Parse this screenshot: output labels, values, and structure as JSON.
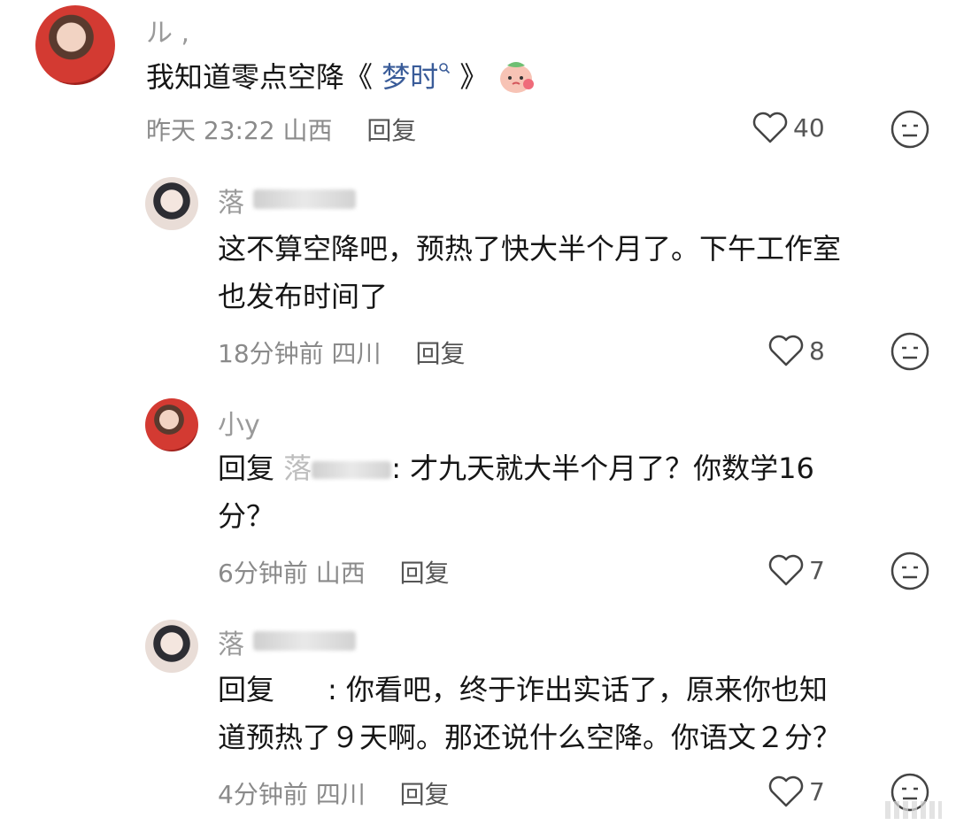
{
  "comments": [
    {
      "user": "ル ,",
      "text_main": "我知道零点空降《 ",
      "text_link": "梦时",
      "text_tail": " 》",
      "time": "昨天 23:22",
      "location": "山西",
      "reply_label": "回复",
      "likes": "40"
    },
    {
      "user": "落",
      "text1": "这不算空降吧，预热了快大半个月了。下午工作室",
      "text2": "也发布时间了",
      "time": "18分钟前",
      "location": "四川",
      "reply_label": "回复",
      "likes": "8"
    },
    {
      "user": "小y",
      "text_prefix": "回复",
      "text_hidden": "落",
      "text_body": ": 才九天就大半个月了？你数学16",
      "text2": "分？",
      "time": "6分钟前",
      "location": "山西",
      "reply_label": "回复",
      "likes": "7"
    },
    {
      "user": "落",
      "text_prefix": "回复",
      "text_body": ": 你看吧，终于诈出实话了，原来你也知",
      "text2": "道预热了９天啊。那还说什么空降。你语文２分？",
      "time": "4分钟前",
      "location": "四川",
      "reply_label": "回复",
      "likes": "7"
    }
  ],
  "colors": {
    "link": "#3a5c99",
    "meta": "#8a8a8a"
  },
  "icons": [
    "heart-icon",
    "meh-face-icon",
    "search-icon",
    "emoji-sticker-icon"
  ]
}
